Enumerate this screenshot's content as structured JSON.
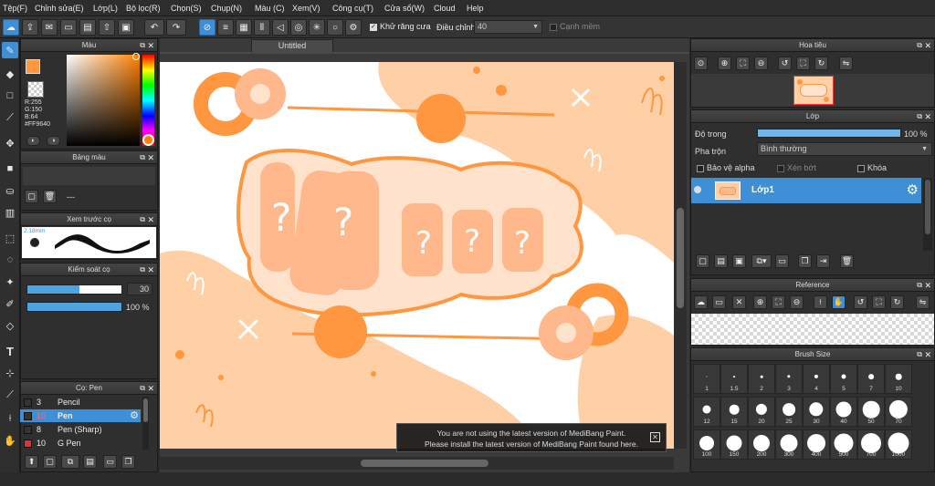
{
  "menu": [
    "Tệp(F)",
    "Chỉnh sửa(E)",
    "Lớp(L)",
    "Bộ lọc(R)",
    "Chọn(S)",
    "Chụp(N)",
    "Màu (C)",
    "Xem(V)",
    "Công cụ(T)",
    "Cửa sổ(W)",
    "Cloud",
    "Help"
  ],
  "toolbar": {
    "antialias_label": "Khử răng cưa",
    "adjust_label": "Điều chỉnh",
    "adjust_value": "40",
    "soft_edge_label": "Cạnh mềm"
  },
  "color_panel": {
    "title": "Màu",
    "r": "R:255",
    "g": "G:150",
    "b": "B:64",
    "hex": "#FF9640",
    "fg": "#ff9640",
    "bg": "#ffffff"
  },
  "palette_panel": {
    "title": "Bảng màu",
    "value": "---"
  },
  "brush_preview": {
    "title": "Xem trước cọ",
    "size": "2.18mm"
  },
  "brush_control": {
    "title": "Kiểm soát cọ",
    "size": "30",
    "opacity": "100 %",
    "size_fill": 0.55,
    "opacity_fill": 1.0
  },
  "brush_list": {
    "title": "Cọ: Pen",
    "items": [
      {
        "num": "3",
        "name": "Pencil",
        "color": "#333333",
        "selected": false
      },
      {
        "num": "10",
        "name": "Pen",
        "color": "#333333",
        "selected": true
      },
      {
        "num": "8",
        "name": "Pen (Sharp)",
        "color": "#333333",
        "selected": false
      },
      {
        "num": "10",
        "name": "G Pen",
        "color": "#e03030",
        "selected": false
      }
    ]
  },
  "canvas": {
    "tab": "Untitled"
  },
  "notice": {
    "line1": "You are not using the latest version of MediBang Paint.",
    "line2": "Please install the latest version of MediBang Paint found here."
  },
  "navigator": {
    "title": "Hoa tiêu"
  },
  "layer_panel": {
    "title": "Lớp",
    "opacity_label": "Độ trong",
    "opacity_value": "100 %",
    "blend_label": "Pha trộn",
    "blend_value": "Bình thường",
    "protect_alpha": "Bảo vệ alpha",
    "clipping": "Xén bớt",
    "lock": "Khóa",
    "layer_name": "Lớp1"
  },
  "reference": {
    "title": "Reference"
  },
  "brush_size": {
    "title": "Brush Size",
    "sizes": [
      "1",
      "1.5",
      "2",
      "3",
      "4",
      "5",
      "7",
      "10",
      "12",
      "15",
      "20",
      "25",
      "30",
      "40",
      "50",
      "70",
      "100",
      "150",
      "200",
      "300",
      "400",
      "500",
      "700",
      "1000"
    ]
  },
  "colors": {
    "accent": "#3f8fd6",
    "panel": "#2f2f2f",
    "orange": "#ff9640",
    "peach": "#ffcfa6"
  }
}
